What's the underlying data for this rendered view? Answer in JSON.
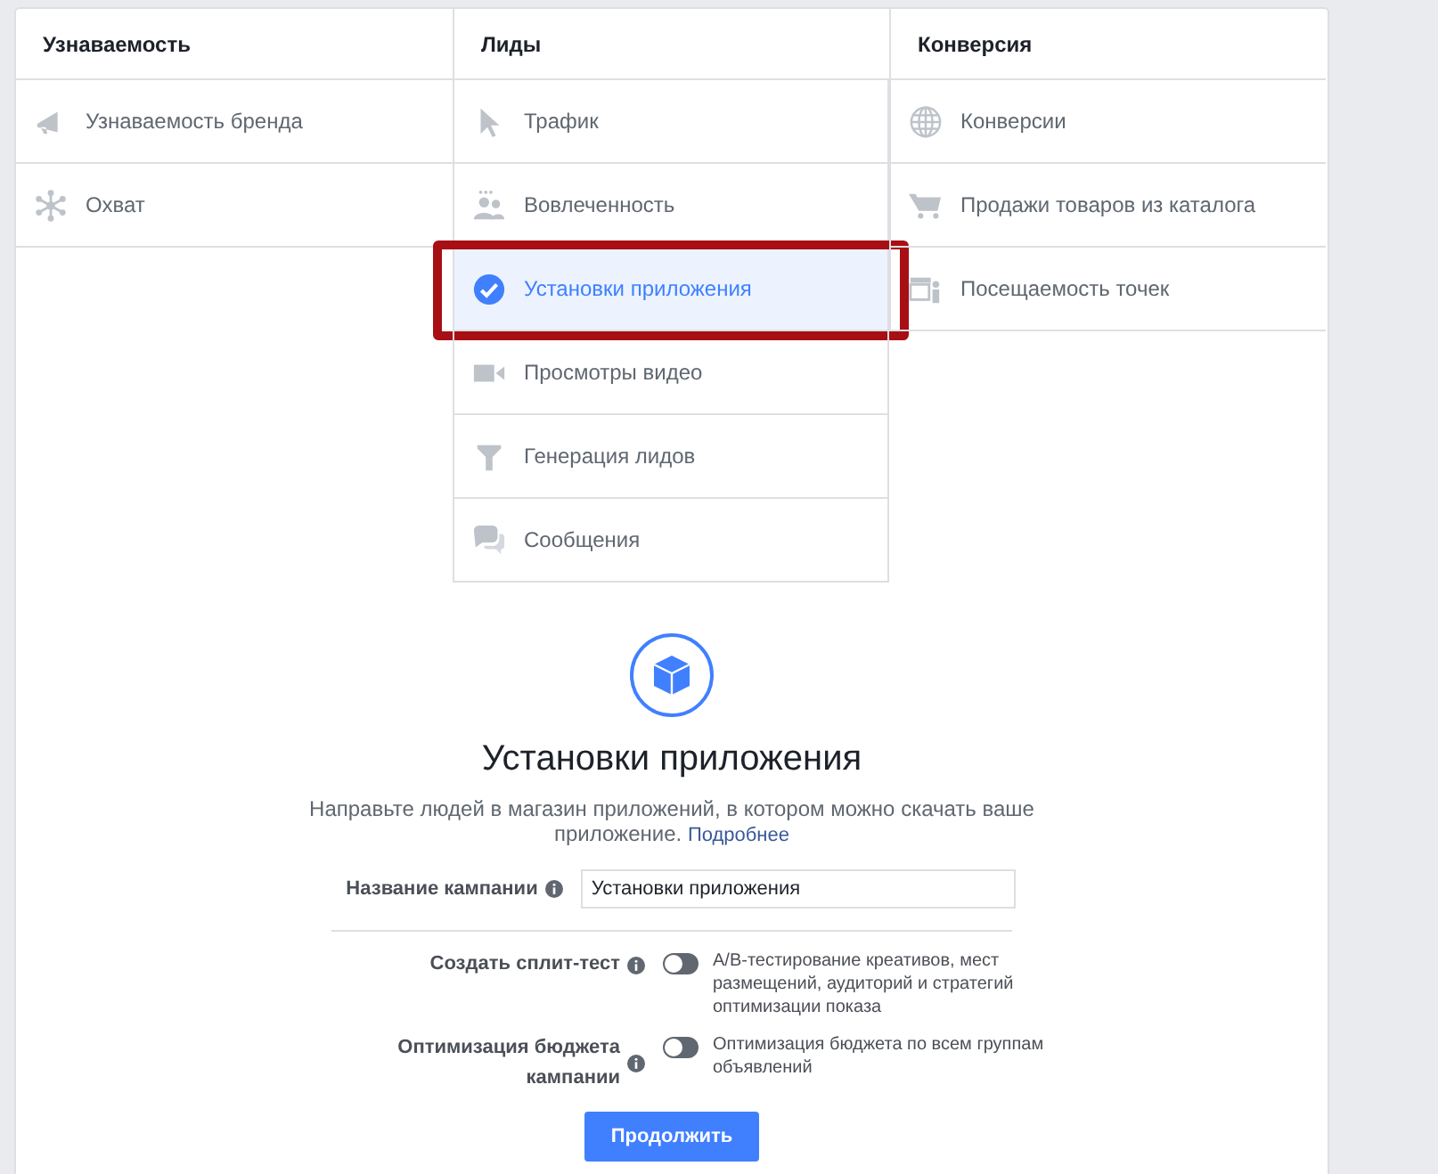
{
  "columns": [
    {
      "title": "Узнаваемость",
      "items": [
        {
          "label": "Узнаваемость бренда",
          "selected": false
        },
        {
          "label": "Охват",
          "selected": false
        }
      ]
    },
    {
      "title": "Лиды",
      "items": [
        {
          "label": "Трафик",
          "selected": false
        },
        {
          "label": "Вовлеченность",
          "selected": false
        },
        {
          "label": "Установки приложения",
          "selected": true
        },
        {
          "label": "Просмотры видео",
          "selected": false
        },
        {
          "label": "Генерация лидов",
          "selected": false
        },
        {
          "label": "Сообщения",
          "selected": false
        }
      ]
    },
    {
      "title": "Конверсия",
      "items": [
        {
          "label": "Конверсии",
          "selected": false
        },
        {
          "label": "Продажи товаров из каталога",
          "selected": false
        },
        {
          "label": "Посещаемость точек",
          "selected": false
        }
      ]
    }
  ],
  "detail": {
    "title": "Установки приложения",
    "description": "Направьте людей в магазин приложений, в котором можно скачать ваше приложение.",
    "link": "Подробнее",
    "campaign_name": {
      "label": "Название кампании",
      "value": "Установки приложения"
    },
    "toggles": [
      {
        "label": "Создать сплит-тест",
        "on": false,
        "description": "A/B-тестирование креативов, мест размещений, аудиторий и стратегий оптимизации показа"
      },
      {
        "label": "Оптимизация бюджета кампании",
        "on": false,
        "description": "Оптимизация бюджета по всем группам объявлений"
      }
    ],
    "button": "Продолжить"
  }
}
